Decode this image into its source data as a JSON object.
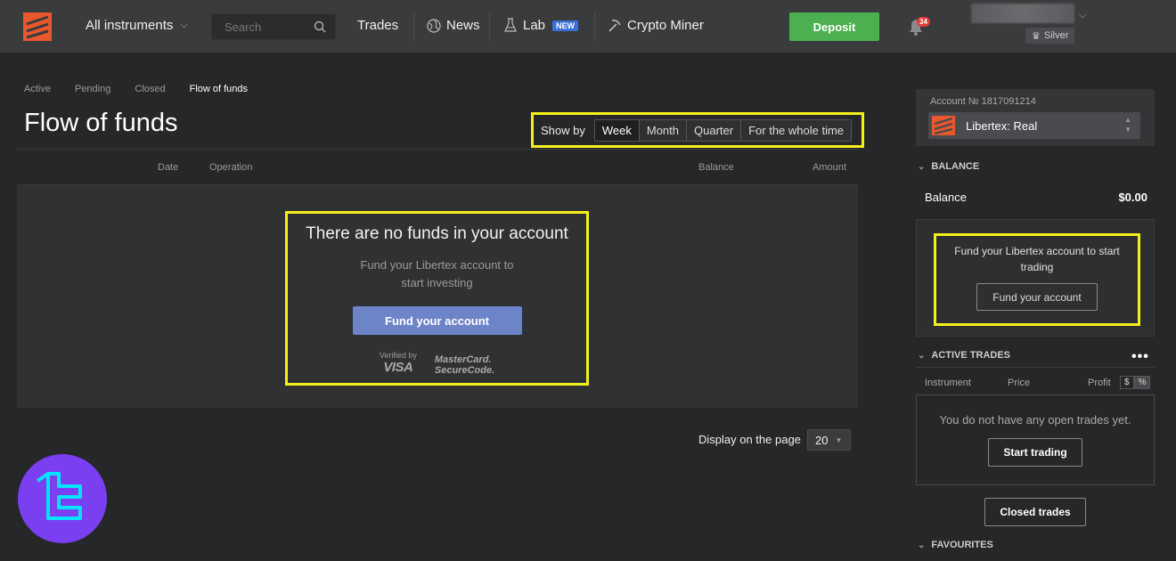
{
  "header": {
    "instruments_label": "All instruments",
    "search_placeholder": "Search",
    "nav": {
      "trades": "Trades",
      "news": "News",
      "lab": "Lab",
      "lab_badge": "NEW",
      "crypto": "Crypto Miner"
    },
    "deposit": "Deposit",
    "notifications": "34",
    "tier": "Silver"
  },
  "tabs": [
    "Active",
    "Pending",
    "Closed",
    "Flow of funds"
  ],
  "page_title": "Flow of funds",
  "show_by": {
    "label": "Show by",
    "options": [
      "Week",
      "Month",
      "Quarter",
      "For the whole time"
    ],
    "selected": "Week"
  },
  "table": {
    "columns": [
      "Date",
      "Operation",
      "Balance",
      "Amount"
    ]
  },
  "empty_state": {
    "title": "There are no funds in your account",
    "subtitle": "Fund your Libertex account to start investing",
    "button": "Fund your account",
    "verified_by": "Verified by",
    "visa": "VISA",
    "mc_line1": "MasterCard.",
    "mc_line2": "SecureCode."
  },
  "pagination": {
    "label": "Display on the page",
    "value": "20"
  },
  "sidebar": {
    "account_label": "Account № 1817091214",
    "account_name": "Libertex: Real",
    "balance_head": "BALANCE",
    "balance_label": "Balance",
    "balance_value": "$0.00",
    "fund_text": "Fund your Libertex account to start trading",
    "fund_button": "Fund your account",
    "active_trades_head": "ACTIVE TRADES",
    "trade_columns": [
      "Instrument",
      "Price",
      "Profit"
    ],
    "toggle": [
      "$",
      "%"
    ],
    "no_trades": "You do not have any open trades yet.",
    "start_trading": "Start trading",
    "closed_trades": "Closed trades",
    "favourites_head": "FAVOURITES"
  },
  "colors": {
    "brand": "#e8572d",
    "deposit": "#4caf50",
    "highlight": "#f5f019",
    "fund_button": "#6d84c9"
  }
}
